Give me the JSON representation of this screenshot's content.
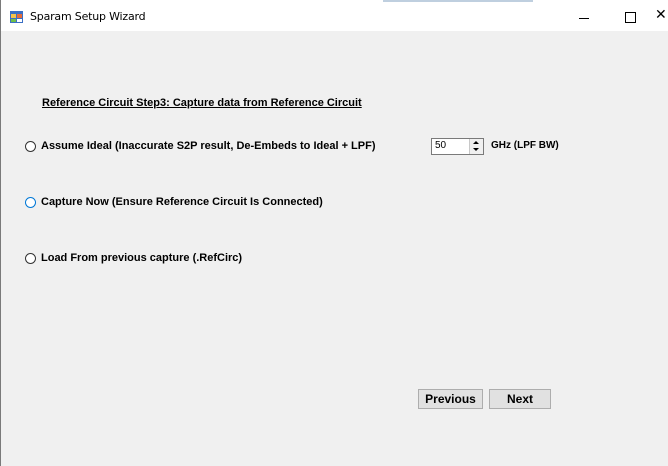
{
  "window": {
    "title": "Sparam Setup Wizard",
    "controls": {
      "minimize": "–",
      "maximize": "☐",
      "close": "✕"
    }
  },
  "heading": "Reference Circuit Step3: Capture data from Reference Circuit",
  "options": [
    {
      "label": "Assume Ideal (Inaccurate S2P result, De-Embeds to Ideal + LPF)",
      "selected": false
    },
    {
      "label": "Capture Now (Ensure Reference Circuit Is Connected)",
      "selected": false,
      "focused": true
    },
    {
      "label": "Load From previous capture (.RefCirc)",
      "selected": false
    }
  ],
  "lpf": {
    "value": "50",
    "unit_label": "GHz (LPF BW)"
  },
  "buttons": {
    "previous": "Previous",
    "next": "Next"
  },
  "colors": {
    "window_bg": "#f0f0f0",
    "focus_accent": "#0078d7",
    "button_bg": "#e1e1e1"
  },
  "icons": {
    "app": "app-window-icon",
    "spin_up": "chevron-up-icon",
    "spin_down": "chevron-down-icon"
  }
}
